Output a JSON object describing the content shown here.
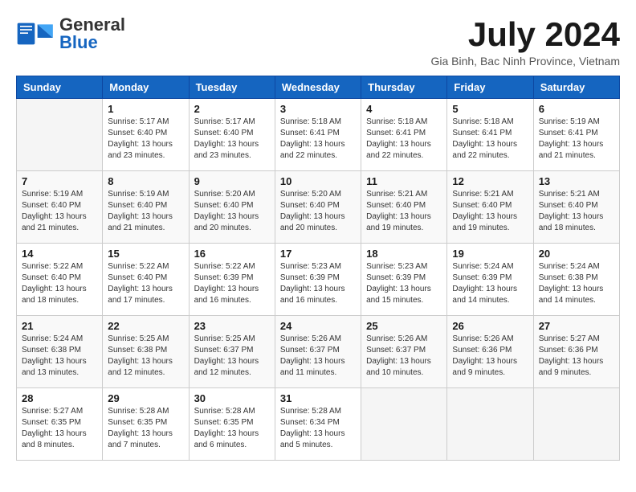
{
  "header": {
    "logo_general": "General",
    "logo_blue": "Blue",
    "month_year": "July 2024",
    "location": "Gia Binh, Bac Ninh Province, Vietnam"
  },
  "calendar": {
    "days_of_week": [
      "Sunday",
      "Monday",
      "Tuesday",
      "Wednesday",
      "Thursday",
      "Friday",
      "Saturday"
    ],
    "weeks": [
      [
        {
          "day": "",
          "info": ""
        },
        {
          "day": "1",
          "info": "Sunrise: 5:17 AM\nSunset: 6:40 PM\nDaylight: 13 hours\nand 23 minutes."
        },
        {
          "day": "2",
          "info": "Sunrise: 5:17 AM\nSunset: 6:40 PM\nDaylight: 13 hours\nand 23 minutes."
        },
        {
          "day": "3",
          "info": "Sunrise: 5:18 AM\nSunset: 6:41 PM\nDaylight: 13 hours\nand 22 minutes."
        },
        {
          "day": "4",
          "info": "Sunrise: 5:18 AM\nSunset: 6:41 PM\nDaylight: 13 hours\nand 22 minutes."
        },
        {
          "day": "5",
          "info": "Sunrise: 5:18 AM\nSunset: 6:41 PM\nDaylight: 13 hours\nand 22 minutes."
        },
        {
          "day": "6",
          "info": "Sunrise: 5:19 AM\nSunset: 6:41 PM\nDaylight: 13 hours\nand 21 minutes."
        }
      ],
      [
        {
          "day": "7",
          "info": "Sunrise: 5:19 AM\nSunset: 6:40 PM\nDaylight: 13 hours\nand 21 minutes."
        },
        {
          "day": "8",
          "info": "Sunrise: 5:19 AM\nSunset: 6:40 PM\nDaylight: 13 hours\nand 21 minutes."
        },
        {
          "day": "9",
          "info": "Sunrise: 5:20 AM\nSunset: 6:40 PM\nDaylight: 13 hours\nand 20 minutes."
        },
        {
          "day": "10",
          "info": "Sunrise: 5:20 AM\nSunset: 6:40 PM\nDaylight: 13 hours\nand 20 minutes."
        },
        {
          "day": "11",
          "info": "Sunrise: 5:21 AM\nSunset: 6:40 PM\nDaylight: 13 hours\nand 19 minutes."
        },
        {
          "day": "12",
          "info": "Sunrise: 5:21 AM\nSunset: 6:40 PM\nDaylight: 13 hours\nand 19 minutes."
        },
        {
          "day": "13",
          "info": "Sunrise: 5:21 AM\nSunset: 6:40 PM\nDaylight: 13 hours\nand 18 minutes."
        }
      ],
      [
        {
          "day": "14",
          "info": "Sunrise: 5:22 AM\nSunset: 6:40 PM\nDaylight: 13 hours\nand 18 minutes."
        },
        {
          "day": "15",
          "info": "Sunrise: 5:22 AM\nSunset: 6:40 PM\nDaylight: 13 hours\nand 17 minutes."
        },
        {
          "day": "16",
          "info": "Sunrise: 5:22 AM\nSunset: 6:39 PM\nDaylight: 13 hours\nand 16 minutes."
        },
        {
          "day": "17",
          "info": "Sunrise: 5:23 AM\nSunset: 6:39 PM\nDaylight: 13 hours\nand 16 minutes."
        },
        {
          "day": "18",
          "info": "Sunrise: 5:23 AM\nSunset: 6:39 PM\nDaylight: 13 hours\nand 15 minutes."
        },
        {
          "day": "19",
          "info": "Sunrise: 5:24 AM\nSunset: 6:39 PM\nDaylight: 13 hours\nand 14 minutes."
        },
        {
          "day": "20",
          "info": "Sunrise: 5:24 AM\nSunset: 6:38 PM\nDaylight: 13 hours\nand 14 minutes."
        }
      ],
      [
        {
          "day": "21",
          "info": "Sunrise: 5:24 AM\nSunset: 6:38 PM\nDaylight: 13 hours\nand 13 minutes."
        },
        {
          "day": "22",
          "info": "Sunrise: 5:25 AM\nSunset: 6:38 PM\nDaylight: 13 hours\nand 12 minutes."
        },
        {
          "day": "23",
          "info": "Sunrise: 5:25 AM\nSunset: 6:37 PM\nDaylight: 13 hours\nand 12 minutes."
        },
        {
          "day": "24",
          "info": "Sunrise: 5:26 AM\nSunset: 6:37 PM\nDaylight: 13 hours\nand 11 minutes."
        },
        {
          "day": "25",
          "info": "Sunrise: 5:26 AM\nSunset: 6:37 PM\nDaylight: 13 hours\nand 10 minutes."
        },
        {
          "day": "26",
          "info": "Sunrise: 5:26 AM\nSunset: 6:36 PM\nDaylight: 13 hours\nand 9 minutes."
        },
        {
          "day": "27",
          "info": "Sunrise: 5:27 AM\nSunset: 6:36 PM\nDaylight: 13 hours\nand 9 minutes."
        }
      ],
      [
        {
          "day": "28",
          "info": "Sunrise: 5:27 AM\nSunset: 6:35 PM\nDaylight: 13 hours\nand 8 minutes."
        },
        {
          "day": "29",
          "info": "Sunrise: 5:28 AM\nSunset: 6:35 PM\nDaylight: 13 hours\nand 7 minutes."
        },
        {
          "day": "30",
          "info": "Sunrise: 5:28 AM\nSunset: 6:35 PM\nDaylight: 13 hours\nand 6 minutes."
        },
        {
          "day": "31",
          "info": "Sunrise: 5:28 AM\nSunset: 6:34 PM\nDaylight: 13 hours\nand 5 minutes."
        },
        {
          "day": "",
          "info": ""
        },
        {
          "day": "",
          "info": ""
        },
        {
          "day": "",
          "info": ""
        }
      ]
    ]
  }
}
